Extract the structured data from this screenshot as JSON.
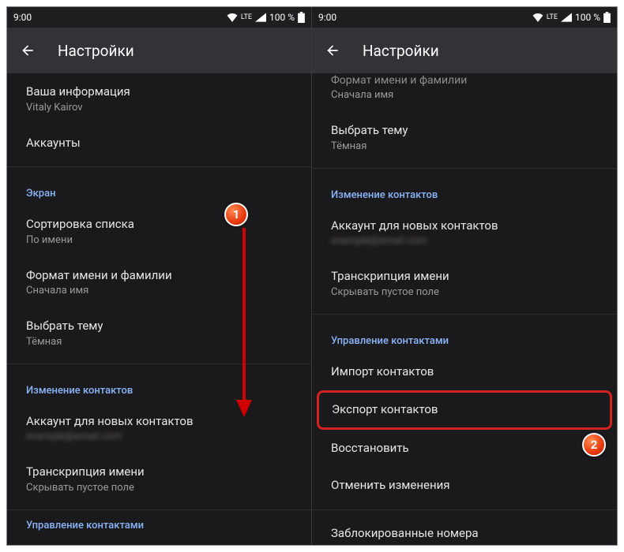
{
  "status": {
    "time": "9:00",
    "lte": "LTE",
    "battery": "100 %"
  },
  "toolbar": {
    "title": "Настройки"
  },
  "left": {
    "your_info_title": "Ваша информация",
    "your_info_sub": "Vitaly Kairov",
    "accounts": "Аккаунты",
    "sec_display": "Экран",
    "sort_title": "Сортировка списка",
    "sort_sub": "По имени",
    "name_format_title": "Формат имени и фамилии",
    "name_format_sub": "Сначала имя",
    "theme_title": "Выбрать тему",
    "theme_sub": "Тёмная",
    "sec_edit": "Изменение контактов",
    "default_account_title": "Аккаунт для новых контактов",
    "default_account_sub": "example@email.com",
    "phonetic_title": "Транскрипция имени",
    "phonetic_sub": "Скрывать пустое поле",
    "sec_manage": "Управление контактами"
  },
  "right": {
    "name_format_cut_title": "Формат имени и фамилии",
    "name_format_cut_sub": "Сначала имя",
    "theme_title": "Выбрать тему",
    "theme_sub": "Тёмная",
    "sec_edit": "Изменение контактов",
    "default_account_title": "Аккаунт для новых контактов",
    "default_account_sub": "example@email.com",
    "phonetic_title": "Транскрипция имени",
    "phonetic_sub": "Скрывать пустое поле",
    "sec_manage": "Управление контактами",
    "import": "Импорт контактов",
    "export": "Экспорт контактов",
    "restore": "Восстановить",
    "undo": "Отменить изменения",
    "blocked": "Заблокированные номера"
  },
  "badges": {
    "one": "1",
    "two": "2"
  },
  "colors": {
    "highlight": "#d12121",
    "accent": "#8ab4f8"
  }
}
